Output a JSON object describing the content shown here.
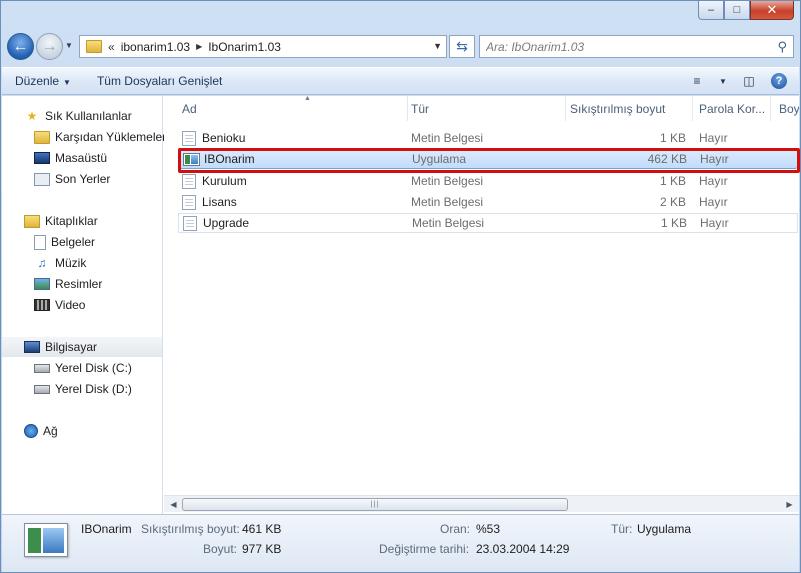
{
  "address": {
    "crumbs": [
      "ibonarim1.03",
      "IbOnarim1.03"
    ],
    "overflow_glyph": "«"
  },
  "search": {
    "placeholder": "Ara: IbOnarim1.03"
  },
  "toolbar": {
    "organize_label": "Düzenle",
    "expand_all_label": "Tüm Dosyaları Genişlet"
  },
  "sidebar": {
    "favorites": {
      "label": "Sık Kullanılanlar",
      "items": [
        "Karşıdan Yüklemeler",
        "Masaüstü",
        "Son Yerler"
      ]
    },
    "libraries": {
      "label": "Kitaplıklar",
      "items": [
        "Belgeler",
        "Müzik",
        "Resimler",
        "Video"
      ]
    },
    "computer": {
      "label": "Bilgisayar",
      "items": [
        "Yerel Disk (C:)",
        "Yerel Disk (D:)"
      ]
    },
    "network": {
      "label": "Ağ"
    }
  },
  "columns": {
    "name": "Ad",
    "type": "Tür",
    "compressed": "Sıkıştırılmış boyut",
    "password": "Parola Kor...",
    "size": "Boy"
  },
  "files": [
    {
      "name": "Benioku",
      "type": "Metin Belgesi",
      "compressed": "1 KB",
      "password": "Hayır"
    },
    {
      "name": "IBOnarim",
      "type": "Uygulama",
      "compressed": "462 KB",
      "password": "Hayır"
    },
    {
      "name": "Kurulum",
      "type": "Metin Belgesi",
      "compressed": "1 KB",
      "password": "Hayır"
    },
    {
      "name": "Lisans",
      "type": "Metin Belgesi",
      "compressed": "2 KB",
      "password": "Hayır"
    },
    {
      "name": "Upgrade",
      "type": "Metin Belgesi",
      "compressed": "1 KB",
      "password": "Hayır"
    }
  ],
  "details": {
    "name": "IBOnarim",
    "compressed_label": "Sıkıştırılmış boyut:",
    "compressed_value": "461 KB",
    "size_label": "Boyut:",
    "size_value": "977 KB",
    "ratio_label": "Oran:",
    "ratio_value": "%53",
    "modified_label": "Değiştirme tarihi:",
    "modified_value": "23.03.2004 14:29",
    "type_label": "Tür:",
    "type_value": "Uygulama"
  }
}
